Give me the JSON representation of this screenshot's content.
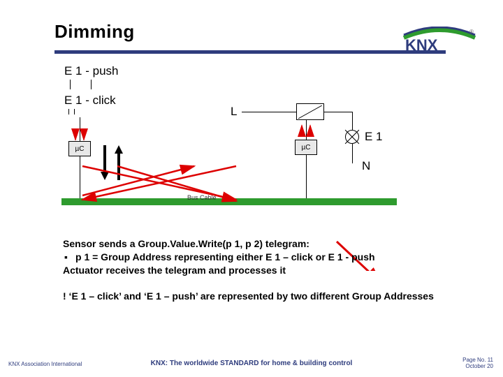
{
  "header": {
    "title": "Dimming",
    "logo_brand": "KNX"
  },
  "diagram": {
    "e1_push": "E 1 - push",
    "e1_click": "E 1 - click",
    "uc_label": "µC",
    "L_label": "L",
    "N_label": "N",
    "E1_label": "E 1",
    "bus_cable": "Bus Cable"
  },
  "body": {
    "line1": "Sensor sends a Group.Value.Write(p 1, p 2) telegram:",
    "bullet1": "p 1 = Group Address representing either E 1 – click or E 1 - push",
    "line2": "Actuator receives the telegram and processes it",
    "note": "! ‘E 1 – click’ and ‘E 1 – push’ are represented by two different Group Addresses"
  },
  "footer": {
    "left": "KNX Association International",
    "center": "KNX: The worldwide STANDARD for home & building control",
    "page_label": "Page No. 11",
    "date": "October 20"
  }
}
